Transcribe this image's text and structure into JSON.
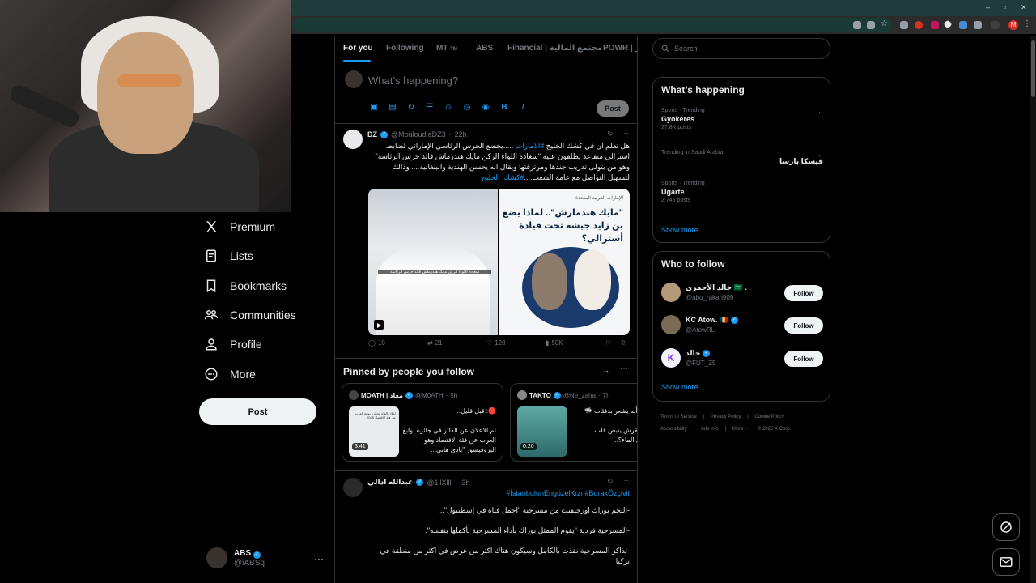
{
  "nav": {
    "premium": "Premium",
    "lists": "Lists",
    "bookmarks": "Bookmarks",
    "communities": "Communities",
    "profile": "Profile",
    "more": "More",
    "post_button": "Post"
  },
  "account": {
    "name": "ABS",
    "handle": "@iABSq"
  },
  "tabs": [
    "For you",
    "Following",
    "MT",
    "ABS",
    "Financial | مجتمع المالية",
    "POWR | نور"
  ],
  "tab_mt_badge": "TM",
  "compose": {
    "placeholder": "What’s happening?",
    "post_label": "Post"
  },
  "tweet1": {
    "name": "DZ",
    "handle": "@MouloudiaDZ3",
    "time": "22h",
    "text_line1_pre": "هل تعلم ان في كشك  الخليج ",
    "text_line1_tag": "#الامارات",
    "text_line1_post": " .....يخضع الحرس الرئاسي الإماراتي  لضابط",
    "text_line2": "استرالي متقاعد يطلقون عليه \"سعادة اللواء الركن مايك هندرماش قائد حرس الرئاسة\"",
    "text_line3": "وهو من يتولى تدريب جندها ومرتزقتها  ويقال انه يحسن الهندية والبنغالية.... وذالك",
    "text_line4_pre": "لتسهيل التواصل مع عامة الشعب....",
    "text_line4_tag": "#كشك_الخليج",
    "media_right_source": "الإمارات العربية المتحدة",
    "media_right_title": "\"مايك هندمارش\".. لماذا يضع بن زايد جيشه تحت قيادة أسترالي؟",
    "media_left_caption": "سعادة اللواء الركن مايك هندرماش قائد حرس الرئاسة",
    "replies": "10",
    "reposts": "21",
    "likes": "128",
    "views": "50K"
  },
  "pinned": {
    "title": "Pinned by people you follow",
    "cards": [
      {
        "name": "MOATH | معاذ",
        "handle": "@M0ATH",
        "time": "5h",
        "duration": "3:41",
        "text": "🔴: قبل قليل...\n\nتم الاعلان عن الفائز في جائزة نوابغ العرب عن فئة الاقتصاد وهو البروفيسور \"بادي هاني...",
        "thumb_caption": "اعلان الفائز بجائزة نوابغ العرب عن فئة الاقتصاد 2025"
      },
      {
        "name": "TAKTO",
        "handle": "@Ne_zaha",
        "time": "7h",
        "duration": "0:20",
        "text": "جة أنه يشعر بدفئات 🦈\n\nر القرش ينبض قلب\nاخل الماء؟..."
      }
    ]
  },
  "tweet2": {
    "name": "عبدالله ادالي",
    "handle": "@1llXllll",
    "time": "3h",
    "tags": "#İstanbulunEngüzelKızı #BurakÖzçivit",
    "line1": "-النجم بوراك اوزجيفيت من مسرحية \"اجمل فتاة في إسطنبول\"...",
    "line2": "-المسرحية فردية \"يقوم الممثل بوراك بأداء المسرحية بأكملها بنفسه\".",
    "line3": "-تذاكر المسرحية نفذت بالكامل وسيكون هناك اكثر من عرض في اكثر من منطقة في",
    "line4": "تركيا"
  },
  "search": {
    "placeholder": "Search"
  },
  "whats_happening": {
    "title": "What’s happening",
    "trends": [
      {
        "context": "Sports · Trending",
        "title": "Gyokeres",
        "count": "27.8K posts"
      },
      {
        "context": "Trending in Saudi Arabia",
        "title": "فيسكا بارسا",
        "count": ""
      },
      {
        "context": "Sports · Trending",
        "title": "Ugarte",
        "count": "2,745 posts"
      }
    ],
    "show_more": "Show more"
  },
  "who_to_follow": {
    "title": "Who to follow",
    "users": [
      {
        "name": "خالد الأحمري 🇸🇦 .",
        "handle": "@abu_rakan909",
        "button": "Follow"
      },
      {
        "name": "KC Atow. 🇷🇴",
        "handle": "@AtowRL",
        "button": "Follow"
      },
      {
        "name": "خالد",
        "handle": "@FUT_Z5",
        "button": "Follow"
      }
    ],
    "show_more": "Show more"
  },
  "footer": {
    "links": [
      "Terms of Service",
      "Privacy Policy",
      "Cookie Policy",
      "Accessibility",
      "Ads info",
      "More ···",
      "© 2025 X Corp."
    ]
  },
  "colors": {
    "accent": "#1d9bf0",
    "background": "#000000",
    "border": "#2f3336",
    "muted": "#71767b"
  }
}
